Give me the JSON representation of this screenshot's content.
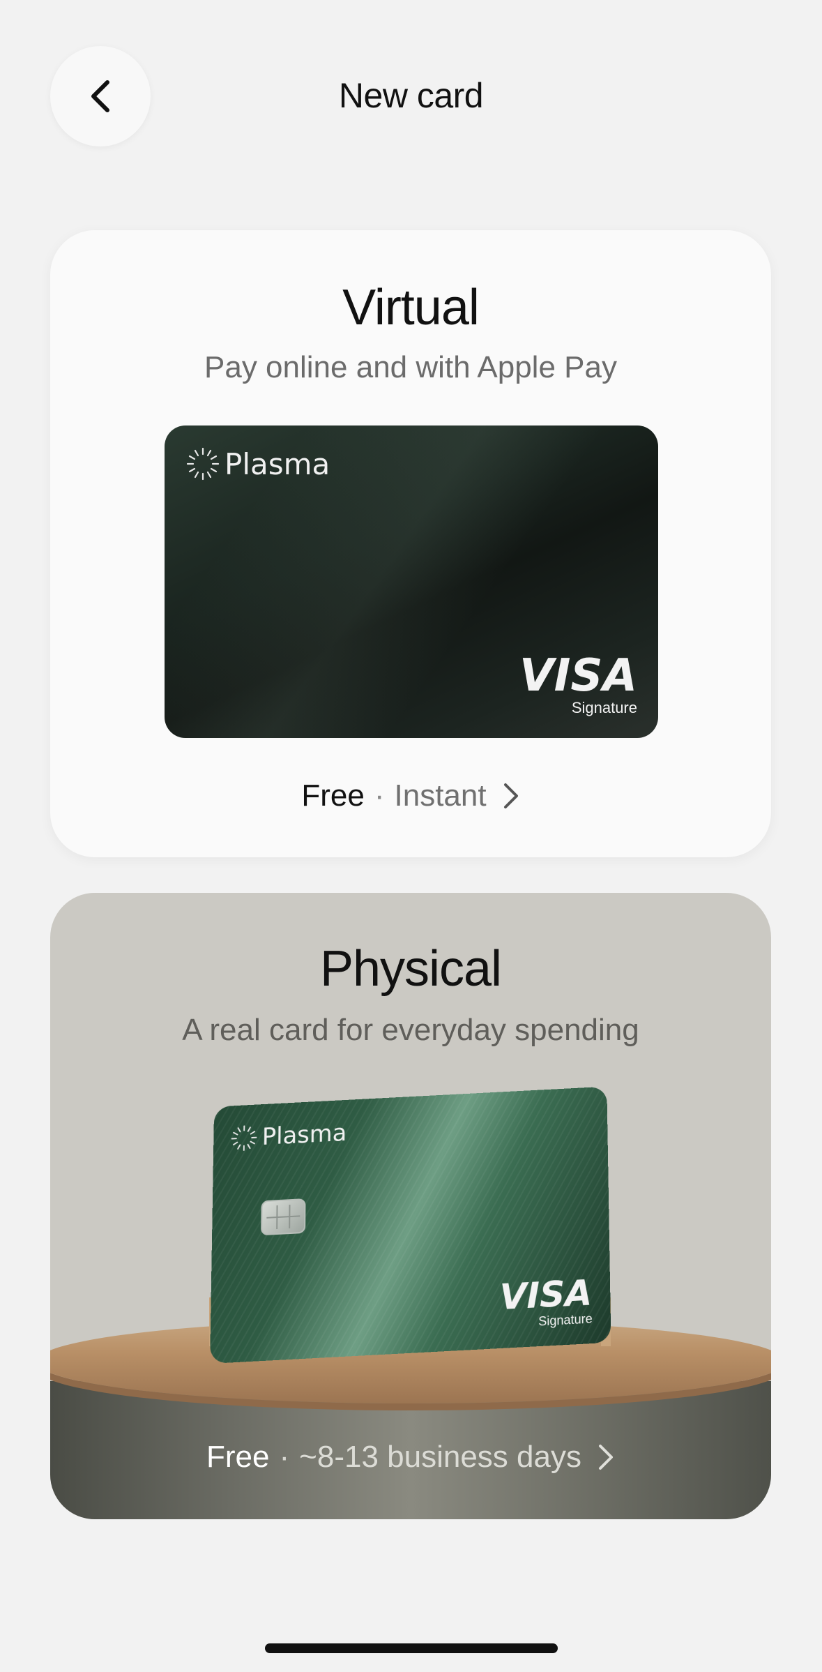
{
  "header": {
    "title": "New card"
  },
  "virtual": {
    "title": "Virtual",
    "subtitle": "Pay online and with Apple Pay",
    "card_brand": "Plasma",
    "card_network": "VISA",
    "card_tier": "Signature",
    "price": "Free",
    "separator": "·",
    "delivery": "Instant"
  },
  "physical": {
    "title": "Physical",
    "subtitle": "A real card for everyday spending",
    "card_brand": "Plasma",
    "card_network": "VISA",
    "card_tier": "Signature",
    "price": "Free",
    "separator": "·",
    "delivery": "~8-13 business days"
  },
  "icons": {
    "back": "chevron-left-icon",
    "forward": "chevron-right-icon",
    "logo": "plasma-logo-icon"
  },
  "colors": {
    "background": "#f2f2f2",
    "virtual_card": "#1a241f",
    "physical_card": "#2f5c44",
    "physical_panel": "#cbc9c3"
  }
}
